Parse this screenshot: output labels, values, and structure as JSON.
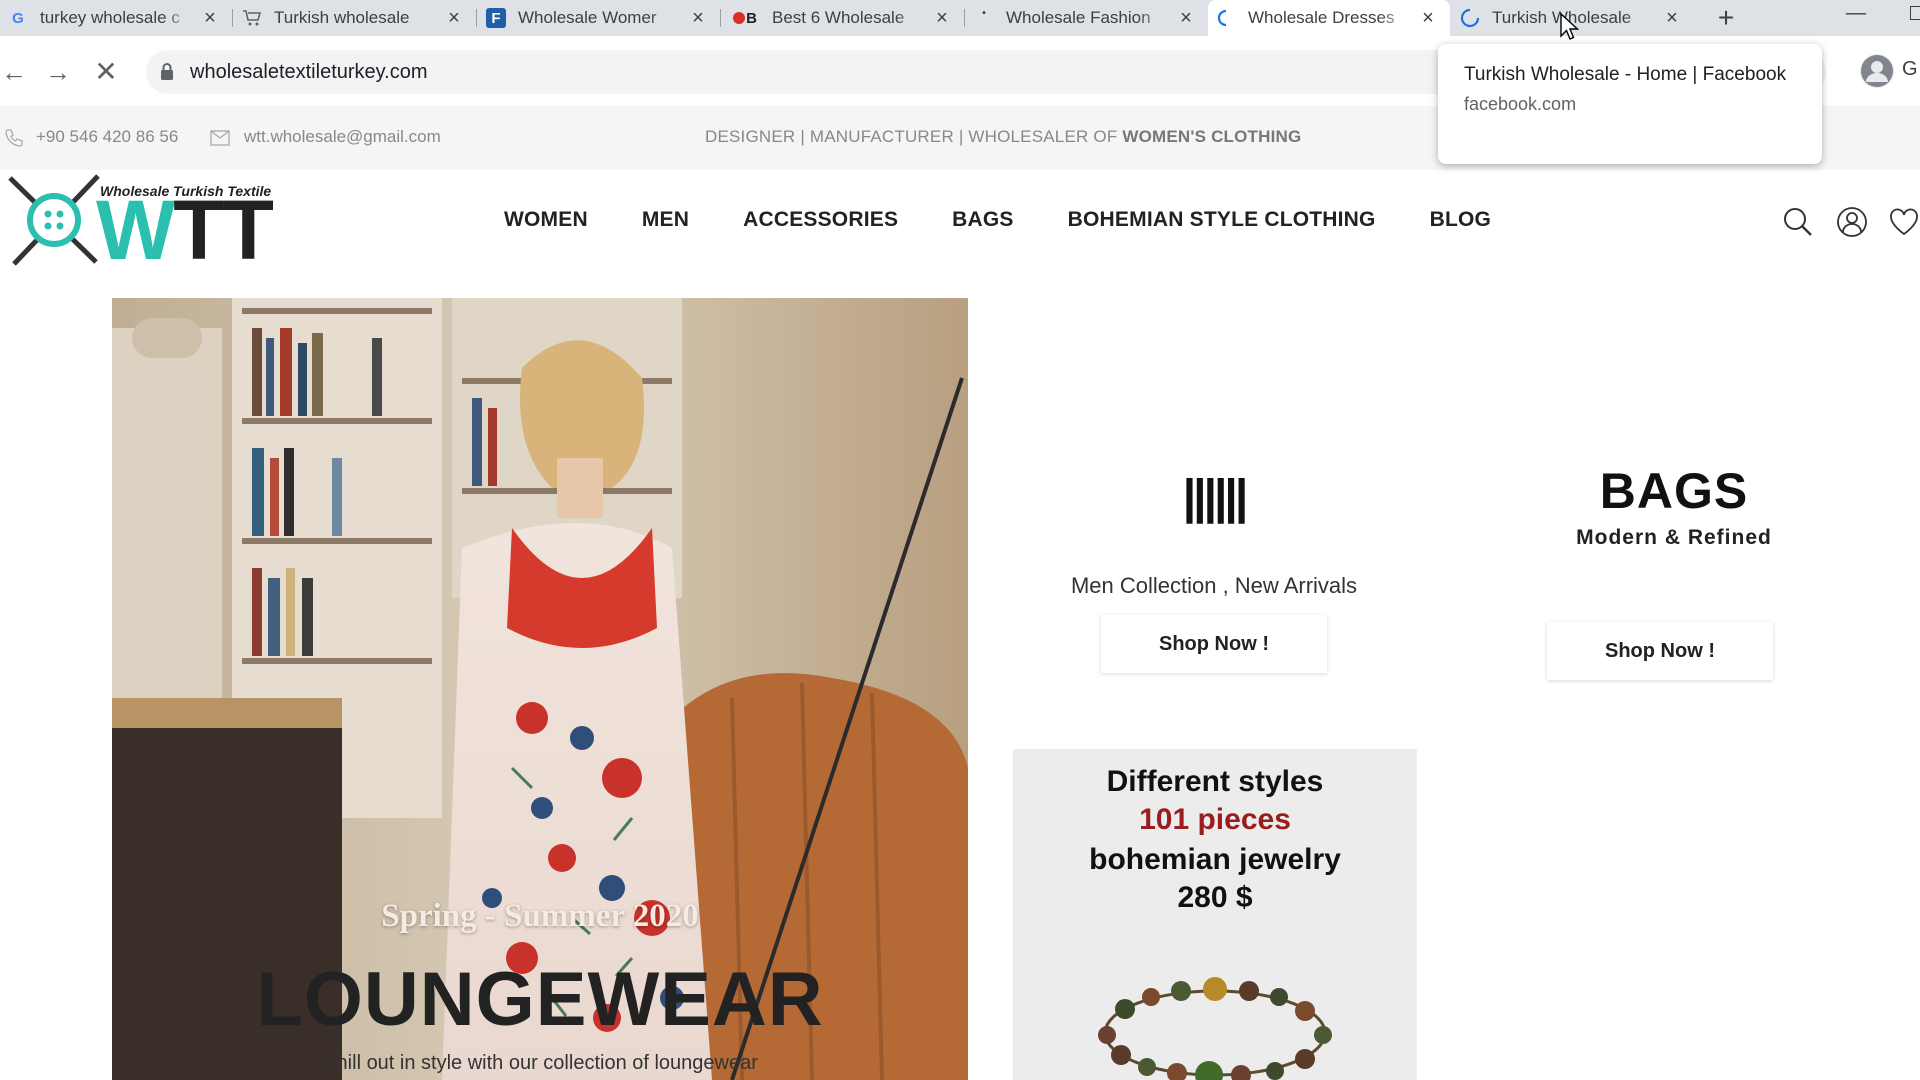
{
  "browser": {
    "tabs": [
      {
        "title": "turkey wholesale c",
        "favicon": "G",
        "favicon_color": "#4285f4"
      },
      {
        "title": "Turkish wholesale",
        "favicon": "cart-icon",
        "favicon_color": "#5f6368"
      },
      {
        "title": "Wholesale Womer",
        "favicon": "F",
        "favicon_color": "#1f5fa8"
      },
      {
        "title": "Best 6 Wholesale",
        "favicon": "B",
        "favicon_color": "#d93025"
      },
      {
        "title": "Wholesale Fashion",
        "favicon": "dot-icon",
        "favicon_color": "#3c4043"
      },
      {
        "title": "Wholesale Dresses",
        "favicon": "loading-icon",
        "favicon_color": "#1a73e8"
      },
      {
        "title": "Turkish Wholesale",
        "favicon": "loading-icon",
        "favicon_color": "#1a73e8"
      }
    ],
    "active_tab_index": 5,
    "new_tab_label": "+",
    "url": "wholesaletextileturkey.com",
    "profile_label": "G",
    "tooltip": {
      "title": "Turkish Wholesale - Home | Facebook",
      "domain": "facebook.com"
    }
  },
  "site": {
    "infobar": {
      "phone": "+90 546 420 86 56",
      "email": "wtt.wholesale@gmail.com",
      "tagline_prefix": "DESIGNER | MANUFACTURER | WHOLESALER OF ",
      "tagline_bold": "WOMEN'S CLOTHING"
    },
    "logo": {
      "subtitle": "Wholesale Turkish Textile",
      "wordmark": "WTT",
      "colors": {
        "w": "#2bbfb0",
        "tt": "#222222"
      }
    },
    "nav": [
      "WOMEN",
      "MEN",
      "ACCESSORIES",
      "BAGS",
      "BOHEMIAN STYLE CLOTHING",
      "BLOG"
    ],
    "hero": {
      "season": "Spring - Summer 2020",
      "title": "LOUNGEWEAR",
      "subtitle": "Chill out in style with our collection of loungewear"
    },
    "men_card": {
      "glyph": "||||||",
      "caption": "Men Collection , New Arrivals",
      "button": "Shop Now !"
    },
    "bags_card": {
      "title": "BAGS",
      "subtitle": "Modern & Refined",
      "button": "Shop Now !"
    },
    "promo": {
      "line1": "Different styles",
      "line2": "101 pieces",
      "line3": "bohemian jewelry",
      "line4": "280 $"
    }
  }
}
